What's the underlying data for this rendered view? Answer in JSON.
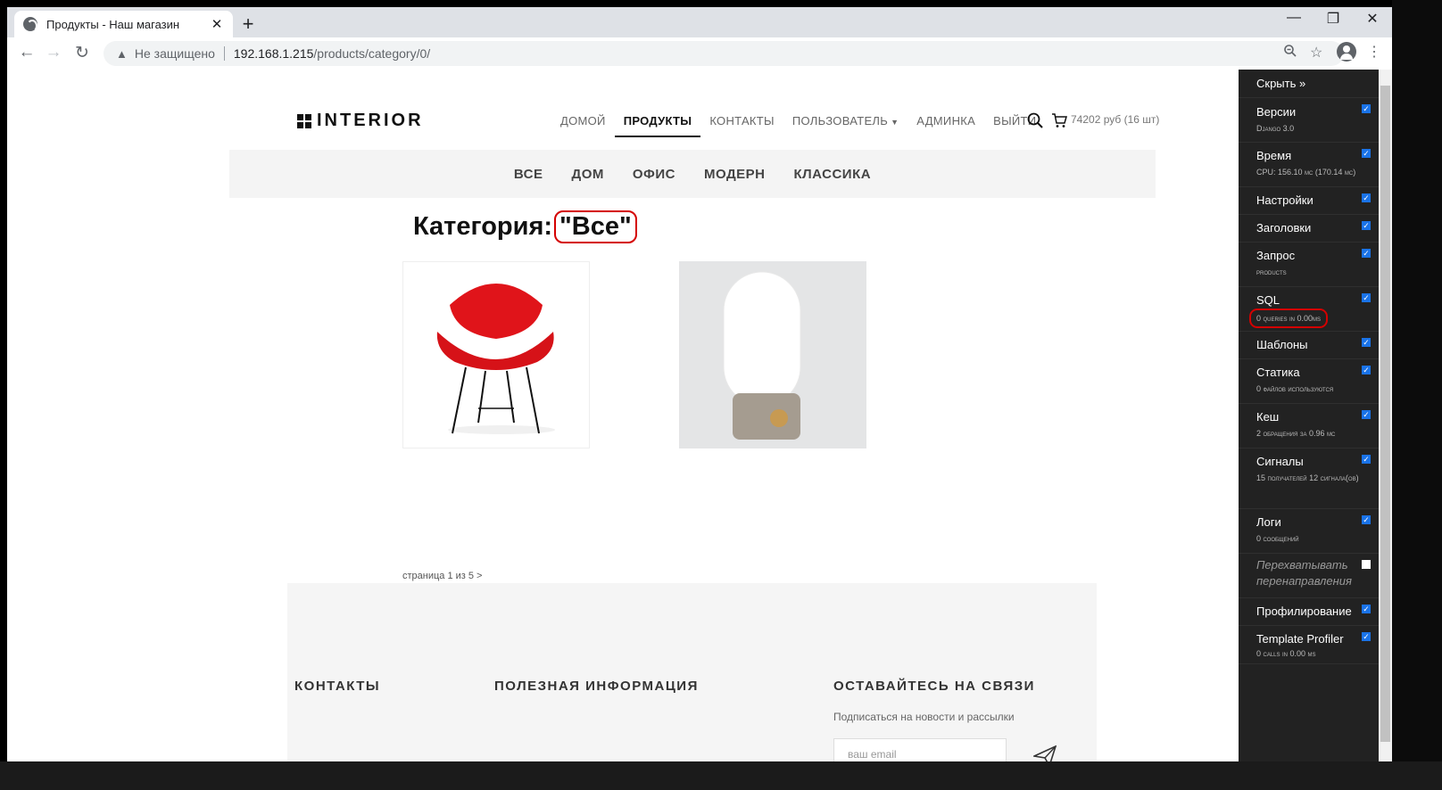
{
  "browser": {
    "tab_title": "Продукты - Наш магазин",
    "tab_close": "✕",
    "new_tab": "+",
    "minimize": "—",
    "restore": "❐",
    "close": "✕",
    "security_label": "Не защищено",
    "url_host": "192.168.1.215",
    "url_path": "/products/category/0/"
  },
  "site": {
    "logo": "INTERIOR",
    "nav": [
      {
        "label": "ДОМОЙ"
      },
      {
        "label": "ПРОДУКТЫ"
      },
      {
        "label": "КОНТАКТЫ"
      },
      {
        "label": "ПОЛЬЗОВАТЕЛЬ"
      },
      {
        "label": "АДМИНКА"
      },
      {
        "label": "ВЫЙТИ"
      }
    ],
    "cart": "74202 руб (16 шт)",
    "categories": [
      "ВСЕ",
      "ДОМ",
      "ОФИС",
      "МОДЕРН",
      "КЛАССИКА"
    ],
    "heading": "Категория:",
    "heading_value": "\"Все\"",
    "pager": "страница 1 из 5 >",
    "footer": {
      "contacts": "КОНТАКТЫ",
      "info": "ПОЛЕЗНАЯ ИНФОРМАЦИЯ",
      "stay": "ОСТАВАЙТЕСЬ НА СВЯЗИ",
      "subscribe": "Подписаться на новости и рассылки",
      "email_placeholder": "ваш email"
    }
  },
  "debug_toolbar": {
    "hide": "Скрыть »",
    "panels": [
      {
        "title": "Версии",
        "sub": "Django 3.0",
        "checked": true
      },
      {
        "title": "Время",
        "sub": "CPU: 156.10 мс (170.14 мс)",
        "checked": true
      },
      {
        "title": "Настройки",
        "sub": "",
        "checked": true
      },
      {
        "title": "Заголовки",
        "sub": "",
        "checked": true
      },
      {
        "title": "Запрос",
        "sub": "products",
        "checked": true
      },
      {
        "title": "SQL",
        "sub": "0 queries in 0.00ms",
        "checked": true
      },
      {
        "title": "Шаблоны",
        "sub": "",
        "checked": true
      },
      {
        "title": "Статика",
        "sub": "0 файлов используются",
        "checked": true
      },
      {
        "title": "Кеш",
        "sub": "2 обращения за 0.96 мс",
        "checked": true
      },
      {
        "title": "Сигналы",
        "sub": "15 получателей 12 сигнала(ов)",
        "checked": true
      },
      {
        "title": "Логи",
        "sub": "0 сообщений",
        "checked": true
      },
      {
        "title": "Перехватывать перенаправления",
        "sub": "",
        "checked": false
      },
      {
        "title": "Профилирование",
        "sub": "",
        "checked": true
      },
      {
        "title": "Template Profiler",
        "sub": "0 calls in 0.00 ms",
        "checked": true
      }
    ]
  },
  "colors": {
    "highlight": "#d40000",
    "toolbar_bg": "#222222",
    "footer_bg": "#f5f5f5"
  }
}
